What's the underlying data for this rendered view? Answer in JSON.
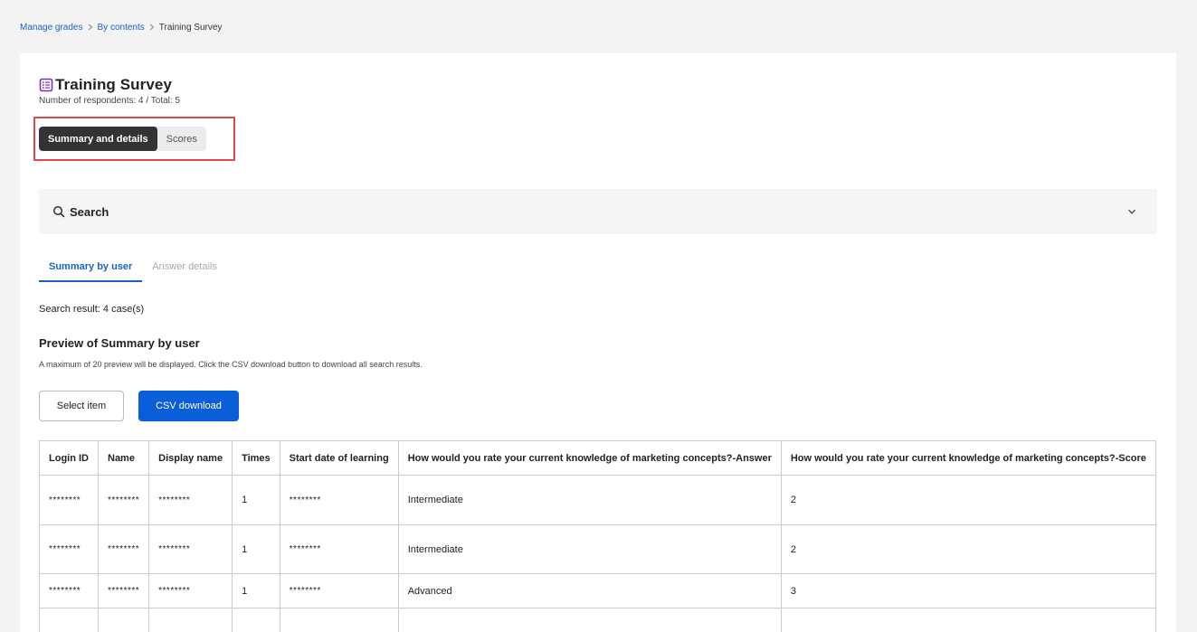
{
  "breadcrumb": {
    "items": [
      "Manage grades",
      "By contents"
    ],
    "current": "Training Survey"
  },
  "header": {
    "title": "Training Survey",
    "respondents": "Number of respondents: 4 / Total: 5"
  },
  "view_toggle": {
    "options": [
      "Summary and details",
      "Scores"
    ],
    "selected": "Summary and details"
  },
  "search": {
    "label": "Search"
  },
  "tabs": {
    "items": [
      "Summary by user",
      "Answer details"
    ],
    "active": "Summary by user"
  },
  "results": {
    "count_text": "Search result: 4 case(s)",
    "preview_title": "Preview of Summary by user",
    "preview_note": "A maximum of 20 preview will be displayed. Click the CSV download button to download all search results."
  },
  "actions": {
    "select_item": "Select item",
    "csv_download": "CSV download"
  },
  "table": {
    "columns": [
      "Login ID",
      "Name",
      "Display name",
      "Times",
      "Start date of learning",
      "How would you rate your current knowledge of marketing concepts?-Answer",
      "How would you rate your current knowledge of marketing concepts?-Score"
    ],
    "rows": [
      [
        "********",
        "********",
        "********",
        "1",
        "********",
        "Intermediate",
        "2"
      ],
      [
        "********",
        "********",
        "********",
        "1",
        "********",
        "Intermediate",
        "2"
      ],
      [
        "********",
        "********",
        "********",
        "1",
        "********",
        "Advanced",
        "3"
      ],
      [
        "",
        "",
        "",
        "",
        "",
        "",
        ""
      ]
    ]
  },
  "colors": {
    "accent": "#0a5fd8",
    "link": "#1c62c5",
    "highlight": "#e04848",
    "icon_purple": "#7b2fbe"
  },
  "icons": {
    "title": "survey-list-icon",
    "search": "search-icon",
    "expand": "chevron-down-icon"
  }
}
